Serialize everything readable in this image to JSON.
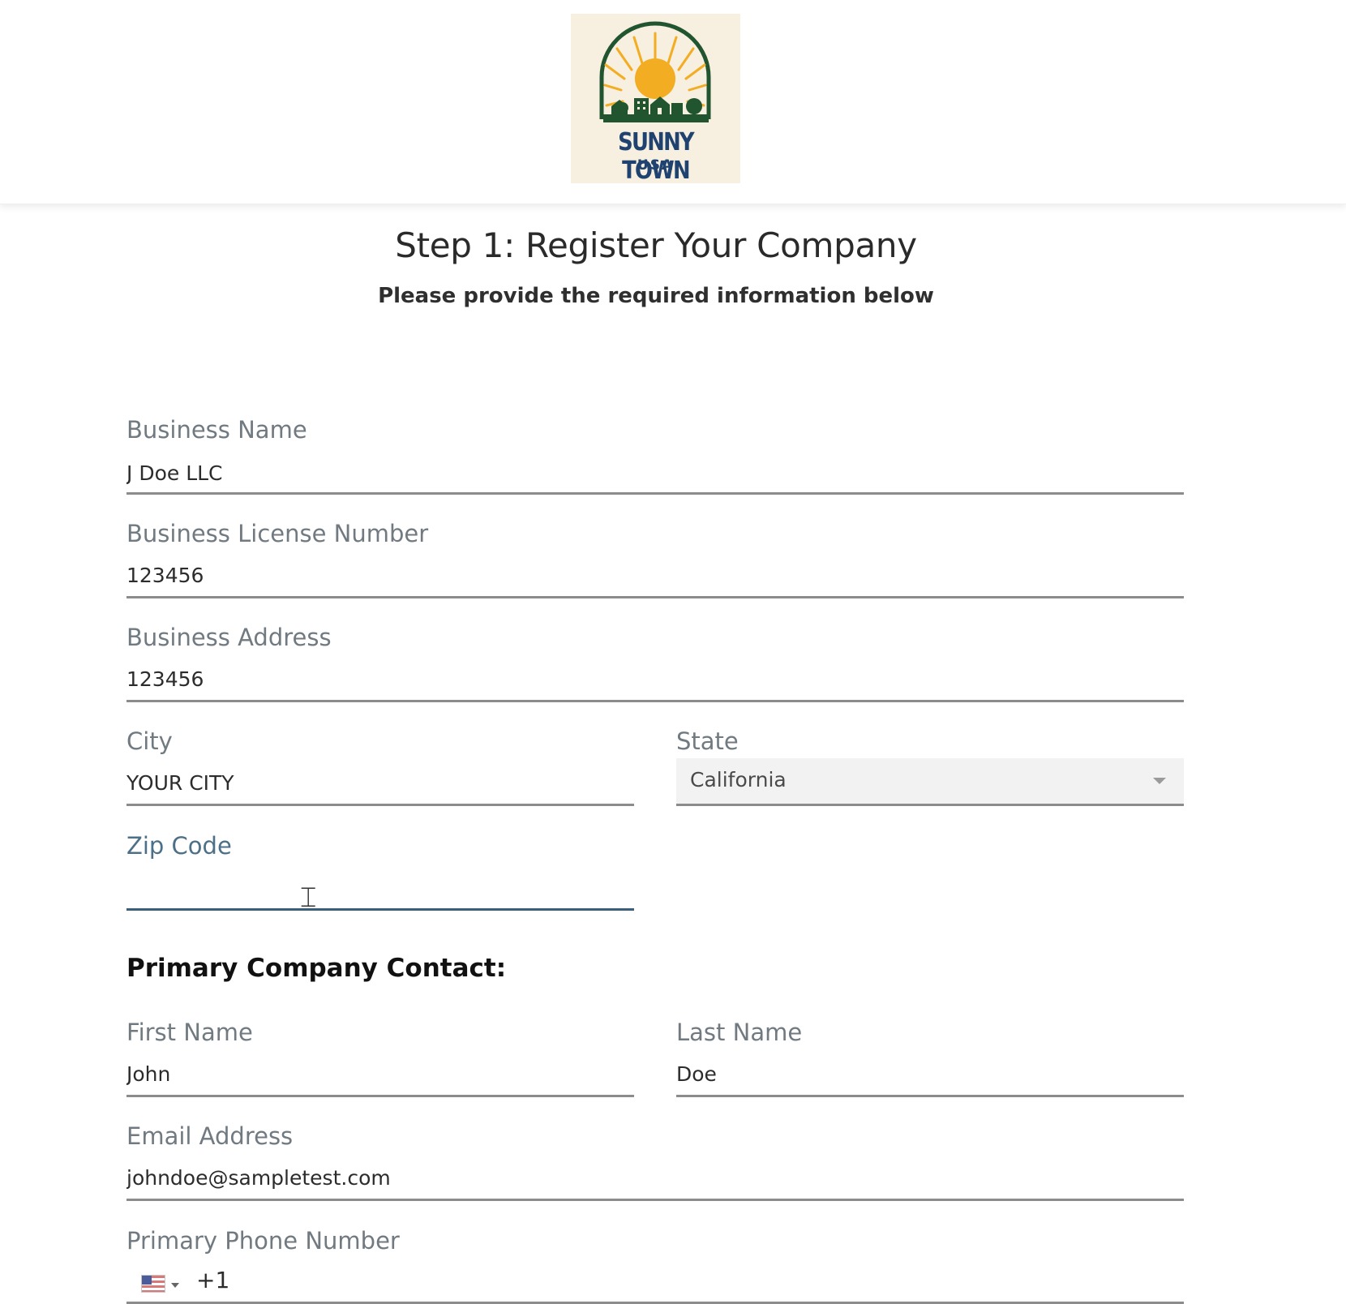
{
  "logo": {
    "line1": "SUNNY TOWN",
    "line2": "USA",
    "colors": {
      "sun": "#f2ad22",
      "green": "#21552f",
      "navy": "#1f4270",
      "background": "#f7efdf"
    }
  },
  "page": {
    "title": "Step 1: Register Your Company",
    "subtitle": "Please provide the required information below"
  },
  "form": {
    "business_name": {
      "label": "Business Name",
      "value": "J Doe LLC"
    },
    "license_number": {
      "label": "Business License Number",
      "value": "123456"
    },
    "address": {
      "label": "Business Address",
      "value": "123456"
    },
    "city": {
      "label": "City",
      "value": "YOUR CITY"
    },
    "state": {
      "label": "State",
      "value": "California"
    },
    "zip": {
      "label": "Zip Code",
      "value": ""
    },
    "contact_heading": "Primary Company Contact:",
    "first_name": {
      "label": "First Name",
      "value": "John"
    },
    "last_name": {
      "label": "Last Name",
      "value": "Doe"
    },
    "email": {
      "label": "Email Address",
      "value": "johndoe@sampletest.com"
    },
    "phone": {
      "label": "Primary Phone Number",
      "dial_code": "+1",
      "country_flag": "us-flag-icon"
    }
  }
}
